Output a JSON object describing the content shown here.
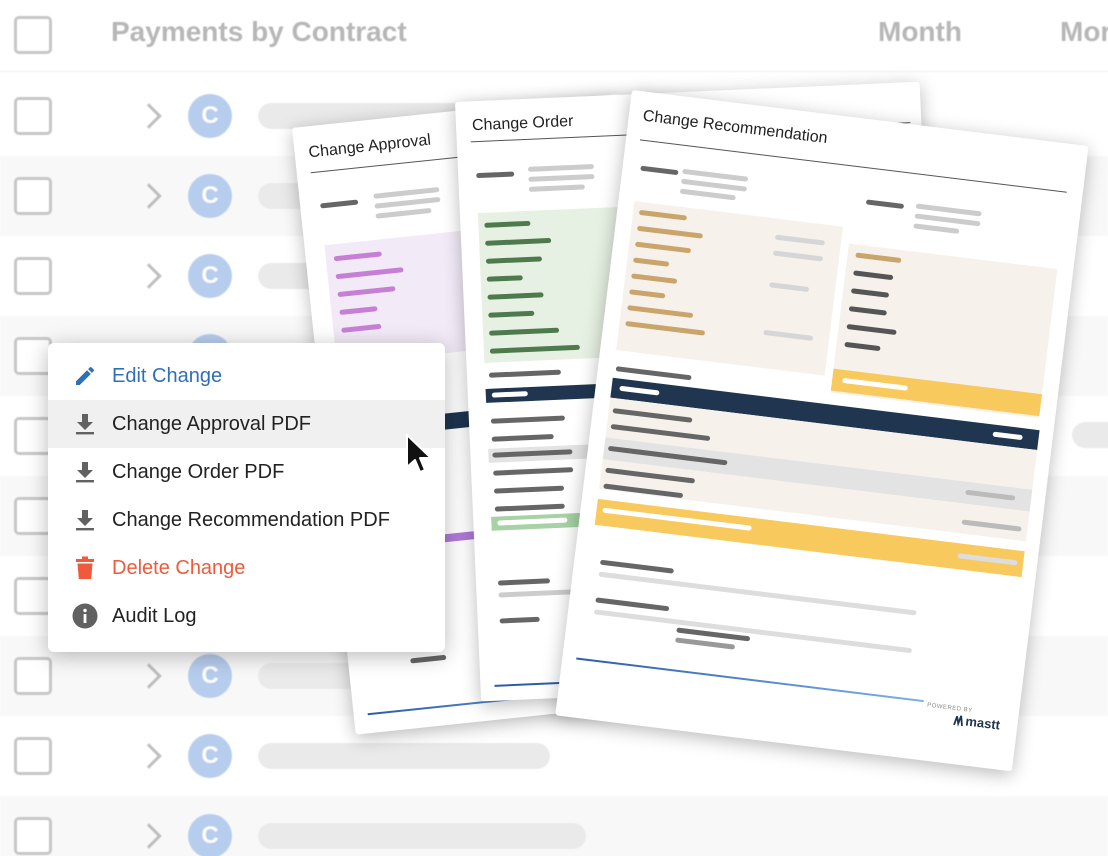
{
  "table": {
    "header": {
      "title": "Payments by Contract",
      "col_month": "Month",
      "col_more": "Mor"
    },
    "avatar_letter": "C"
  },
  "documents": {
    "approval_title": "Change Approval",
    "order_title": "Change Order",
    "recommendation_title": "Change Recommendation",
    "powered_by": "POWERED BY",
    "brand": "mastt"
  },
  "menu": {
    "items": [
      {
        "label": "Edit Change",
        "icon": "pencil-icon"
      },
      {
        "label": "Change Approval PDF",
        "icon": "download-icon"
      },
      {
        "label": "Change Order PDF",
        "icon": "download-icon"
      },
      {
        "label": "Change Recommendation PDF",
        "icon": "download-icon"
      },
      {
        "label": "Delete Change",
        "icon": "trash-icon"
      },
      {
        "label": "Audit Log",
        "icon": "info-icon"
      }
    ]
  },
  "colors": {
    "edit": "#2f6fb7",
    "delete": "#ef5a3c",
    "avatar": "#7ea6e0",
    "approval_accent": "#c77fd6",
    "order_accent": "#4e7a4d",
    "recommendation_accent": "#c9a56b",
    "navy": "#1f3550",
    "highlight": "#f8c95c"
  }
}
